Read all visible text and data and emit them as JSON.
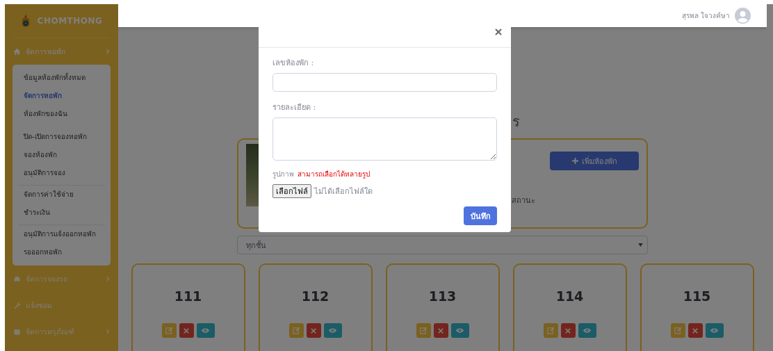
{
  "sidebar": {
    "brand": "CHOMTHONG",
    "menu": [
      {
        "kind": "group",
        "label": "จัดการหอพัก",
        "expanded": true,
        "sections": [
          {
            "divider": false,
            "items": [
              {
                "label": "ข้อมูลห้องพักทั้งหมด",
                "selected": false
              },
              {
                "label": "จัดการหอพัก",
                "selected": true
              },
              {
                "label": "ห้องพักของฉัน",
                "selected": false
              }
            ]
          },
          {
            "divider": false,
            "items": [
              {
                "label": "ปิด-เปิดการจองหอพัก",
                "selected": false
              },
              {
                "label": "จองห้องพัก",
                "selected": false
              },
              {
                "label": "อนุมัติการจอง",
                "selected": false
              }
            ]
          },
          {
            "divider": true,
            "items": [
              {
                "label": "จัดการค่าใช้จ่าย",
                "selected": false
              },
              {
                "label": "ชำระเงิน",
                "selected": false
              }
            ]
          },
          {
            "divider": true,
            "items": [
              {
                "label": "อนุมัติการแจ้งออกหอพัก",
                "selected": false
              },
              {
                "label": "รอออกหอพัก",
                "selected": false
              }
            ]
          }
        ]
      },
      {
        "kind": "group",
        "label": "จัดการจองรถ",
        "expanded": false
      },
      {
        "kind": "link",
        "label": "แจ้งซ่อม"
      },
      {
        "kind": "group",
        "label": "จัดการครุภัณฑ์",
        "expanded": false
      }
    ]
  },
  "topbar": {
    "user_name": "สุรพล ใจวงค์ษา"
  },
  "content": {
    "heading_visible": "ร",
    "info_card": {
      "add_button": "เพิ่มห้องพัก",
      "status_text": "สถานะ"
    },
    "floor_filter": {
      "value": "ทุกชั้น"
    },
    "rooms": [
      {
        "number": "111"
      },
      {
        "number": "112"
      },
      {
        "number": "113"
      },
      {
        "number": "114"
      },
      {
        "number": "115"
      }
    ]
  },
  "modal": {
    "fields": [
      {
        "kind": "input",
        "label": "เลขห้องพัก :"
      },
      {
        "kind": "textarea",
        "label": "รายละเอียด :"
      }
    ],
    "image_label": "รูปภาพ",
    "image_hint": "สามารถเลือกได้หลายรูป",
    "file_button": "เลือกไฟล์",
    "file_status": "ไม่ได้เลือกไฟล์ใด",
    "save_button": "บันทึก"
  }
}
